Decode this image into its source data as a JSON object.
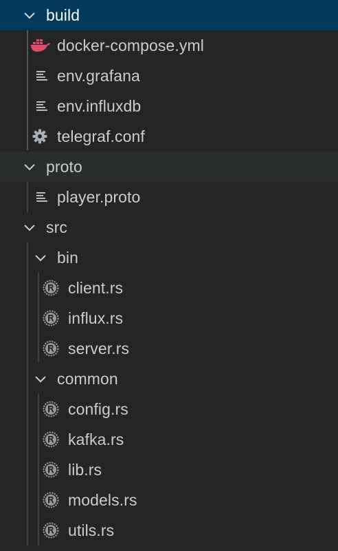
{
  "explorer": {
    "build": {
      "label": "build",
      "files": {
        "docker_compose": "docker-compose.yml",
        "env_grafana": "env.grafana",
        "env_influxdb": "env.influxdb",
        "telegraf": "telegraf.conf"
      }
    },
    "proto": {
      "label": "proto",
      "files": {
        "player_proto": "player.proto"
      }
    },
    "src": {
      "label": "src",
      "bin": {
        "label": "bin",
        "files": {
          "client": "client.rs",
          "influx": "influx.rs",
          "server": "server.rs"
        }
      },
      "common": {
        "label": "common",
        "files": {
          "config": "config.rs",
          "kafka": "kafka.rs",
          "lib": "lib.rs",
          "models": "models.rs",
          "utils": "utils.rs"
        }
      }
    }
  },
  "icons": {
    "chevron": "chevron-down-icon",
    "docker": "docker-icon",
    "text": "text-file-icon",
    "gear": "gear-icon",
    "rust": "rust-icon"
  },
  "colors": {
    "background": "#252526",
    "selected": "#04395e",
    "hover": "#2a2d2e",
    "text": "#cccccc",
    "docker": "#e24a6d",
    "icon": "#b8b8b8",
    "rust": "#9a9a9a"
  }
}
